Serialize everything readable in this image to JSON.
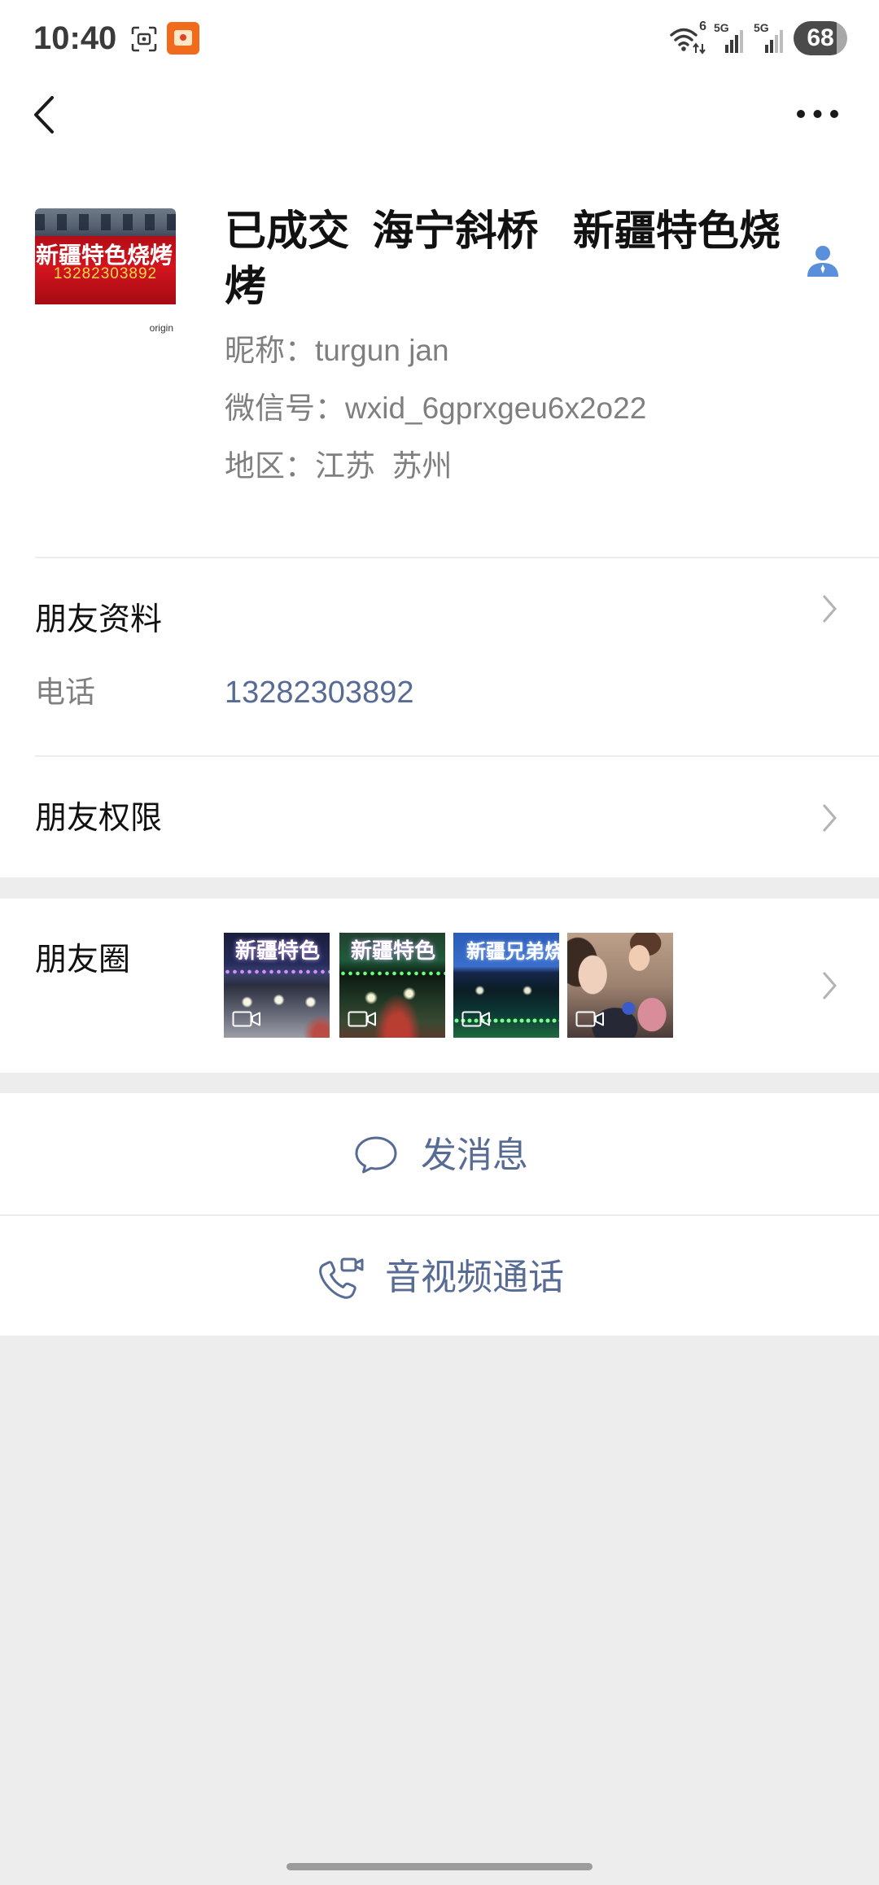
{
  "status_bar": {
    "time": "10:40",
    "screenshot_icon": "screenshot-icon",
    "app_icon": "app-notification-icon",
    "wifi_icon": "wifi-icon",
    "wifi_badge": "6",
    "signal_1_label": "5G",
    "signal_2_label": "5G",
    "battery": "68"
  },
  "nav": {
    "back_icon": "chevron-left-icon",
    "more_icon": "more-horizontal-icon"
  },
  "profile": {
    "avatar": {
      "sign_text": "新疆特色烧烤",
      "sign_phone": "13282303892",
      "watermark": "origin"
    },
    "name": "已成交  海宁斜桥   新疆特色烧烤",
    "contact_icon": "contact-person-icon",
    "nickname": "昵称：turgun jan",
    "wechat_id": "微信号：wxid_6gprxgeu6x2o22",
    "region": "地区：江苏  苏州"
  },
  "friend_info": {
    "title": "朋友资料",
    "phone_label": "电话",
    "phone_value": "13282303892",
    "chevron_icon": "chevron-right-icon"
  },
  "friend_permissions": {
    "title": "朋友权限",
    "chevron_icon": "chevron-right-icon"
  },
  "moments": {
    "title": "朋友圈",
    "chevron_icon": "chevron-right-icon",
    "thumbnails": [
      {
        "caption": "新疆特色",
        "icon": "video-icon"
      },
      {
        "caption": "新疆特色",
        "icon": "video-icon"
      },
      {
        "caption": "新疆兄弟烧",
        "icon": "video-icon"
      },
      {
        "icon": "video-icon"
      }
    ]
  },
  "actions": {
    "message": {
      "label": "发消息",
      "icon": "chat-bubble-icon"
    },
    "call": {
      "label": "音视频通话",
      "icon": "video-call-icon"
    }
  },
  "colors": {
    "link": "#576b95",
    "contact_icon": "#5a8fdc",
    "page_background": "#ededed",
    "secondary_text": "#808080",
    "chevron": "#b3b3b3"
  }
}
